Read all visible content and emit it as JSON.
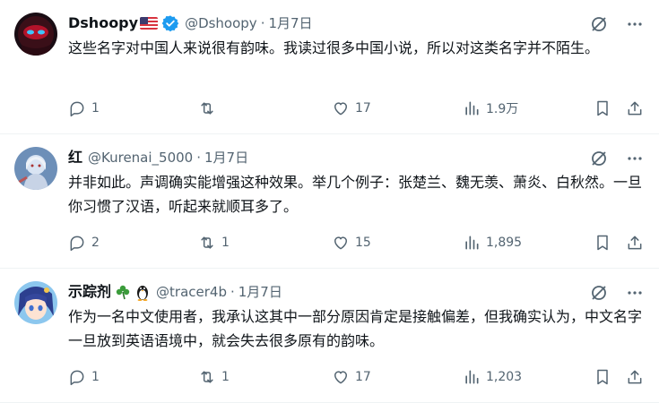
{
  "tweets": [
    {
      "name": "Dshoopy",
      "handle": "@Dshoopy",
      "separator": "·",
      "date": "1月7日",
      "text": "这些名字对中国人来说很有韵味。我读过很多中国小说，所以对这类名字并不陌生。",
      "stats": {
        "replies": "1",
        "retweets": "",
        "likes": "17",
        "views": "1.9万"
      }
    },
    {
      "name": "红",
      "handle": "@Kurenai_5000",
      "separator": "·",
      "date": "1月7日",
      "text": "并非如此。声调确实能增强这种效果。举几个例子：张楚兰、魏无羡、萧炎、白秋然。一旦你习惯了汉语，听起来就顺耳多了。",
      "stats": {
        "replies": "2",
        "retweets": "1",
        "likes": "15",
        "views": "1,895"
      }
    },
    {
      "name": "示踪剂",
      "handle": "@tracer4b",
      "separator": "·",
      "date": "1月7日",
      "text": "作为一名中文使用者，我承认这其中一部分原因肯定是接触偏差，但我确实认为，中文名字一旦放到英语语境中，就会失去很多原有的韵味。",
      "stats": {
        "replies": "1",
        "retweets": "1",
        "likes": "17",
        "views": "1,203"
      }
    }
  ],
  "colors": {
    "text": "#0f1419",
    "secondary": "#536471",
    "verified": "#1d9bf0",
    "divider": "#eff3f4"
  },
  "icons": [
    "grok-icon",
    "more-icon",
    "reply-icon",
    "retweet-icon",
    "like-icon",
    "views-icon",
    "bookmark-icon",
    "share-icon",
    "verified-icon",
    "us-flag-icon",
    "shamrock-icon",
    "penguin-icon"
  ]
}
